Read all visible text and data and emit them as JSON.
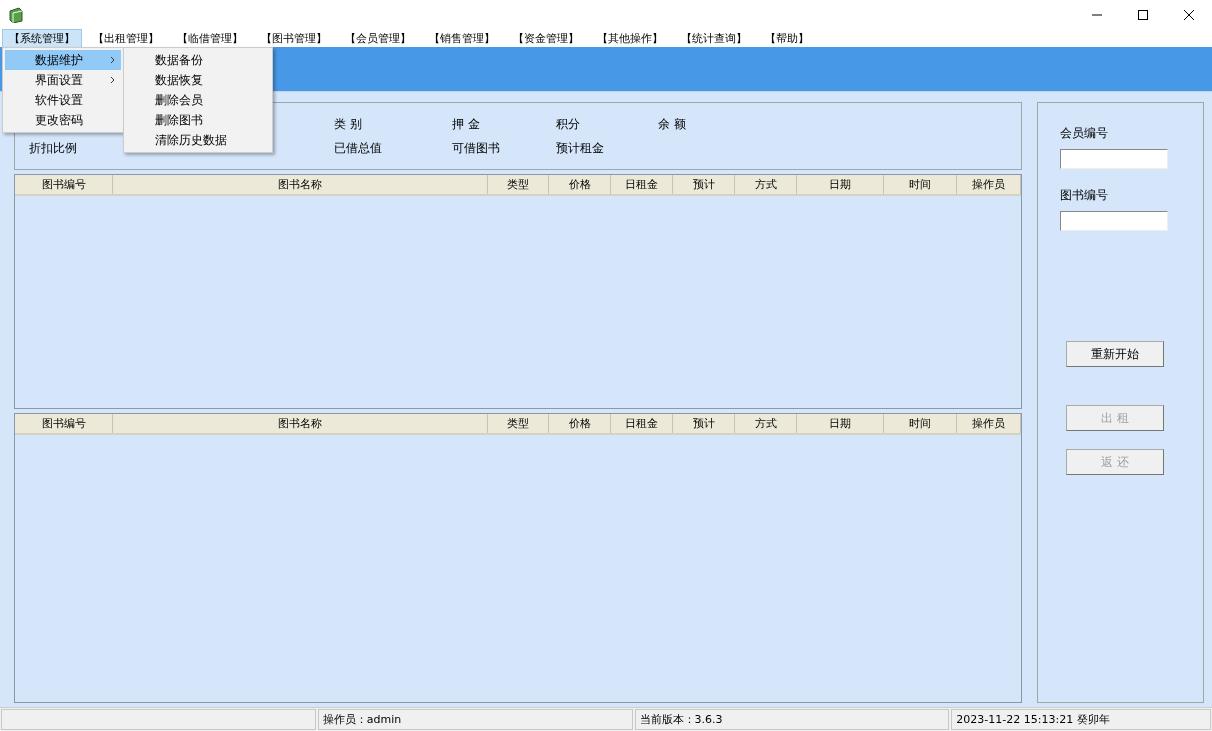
{
  "menu_bar": [
    {
      "label": "【系统管理】",
      "selected": true
    },
    {
      "label": "【出租管理】",
      "selected": false
    },
    {
      "label": "【临借管理】",
      "selected": false
    },
    {
      "label": "【图书管理】",
      "selected": false
    },
    {
      "label": "【会员管理】",
      "selected": false
    },
    {
      "label": "【销售管理】",
      "selected": false
    },
    {
      "label": "【资金管理】",
      "selected": false
    },
    {
      "label": "【其他操作】",
      "selected": false
    },
    {
      "label": "【统计查询】",
      "selected": false
    },
    {
      "label": "【帮助】",
      "selected": false
    }
  ],
  "dropdown": [
    {
      "label": "数据维护",
      "submenu": true,
      "selected": true
    },
    {
      "label": "界面设置",
      "submenu": true,
      "selected": false
    },
    {
      "label": "软件设置",
      "submenu": false,
      "selected": false
    },
    {
      "label": "更改密码",
      "submenu": false,
      "selected": false
    }
  ],
  "submenu": [
    "数据备份",
    "数据恢复",
    "删除会员",
    "删除图书",
    "清除历史数据"
  ],
  "info_rows": [
    [
      "类 别",
      "押 金",
      "积分",
      "余 额"
    ],
    [
      "折扣比例",
      "已借总值",
      "可借图书",
      "预计租金"
    ]
  ],
  "tables": [
    {
      "columns": [
        "图书编号",
        "图书名称",
        "类型",
        "价格",
        "日租金",
        "预计",
        "方式",
        "日期",
        "时间",
        "操作员"
      ]
    },
    {
      "columns": [
        "图书编号",
        "图书名称",
        "类型",
        "价格",
        "日租金",
        "预计",
        "方式",
        "日期",
        "时间",
        "操作员"
      ]
    }
  ],
  "side_fields": [
    {
      "label": "会员编号"
    },
    {
      "label": "图书编号"
    }
  ],
  "side_buttons": [
    {
      "label": "重新开始",
      "disabled": false
    },
    {
      "label": "出 租",
      "disabled": true
    },
    {
      "label": "返 还",
      "disabled": true
    }
  ],
  "status_bar": [
    "操作员：admin",
    "当前版本：3.6.3",
    "2023-11-22 15:13:21 癸卯年"
  ]
}
